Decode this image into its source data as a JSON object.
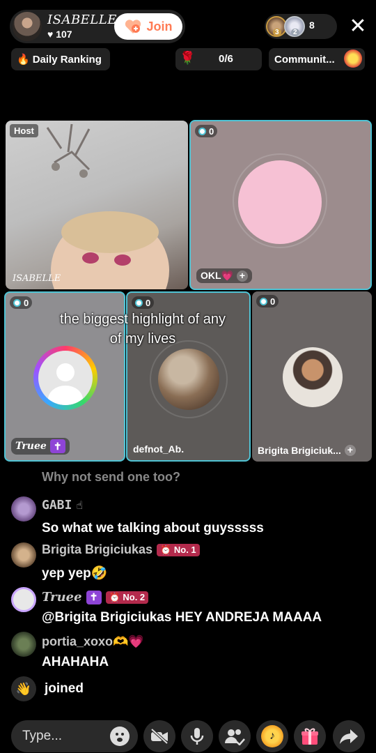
{
  "header": {
    "host_name": "ISABELLE",
    "likes": "107",
    "join_label": "Join",
    "viewer_count": "8",
    "viewer_ranks": [
      "3",
      "2"
    ],
    "close_label": "✕"
  },
  "chips": {
    "daily_ranking": "Daily Ranking",
    "gift_goal": "0/6",
    "community": "Communit..."
  },
  "tiles": {
    "host_tag": "Host",
    "host_name": "ISABELLE",
    "seats": [
      {
        "count": "0",
        "label": "OKL💗"
      },
      {
        "count": "0",
        "label": "Truee"
      },
      {
        "count": "0",
        "label": "defnot_Ab."
      },
      {
        "count": "0",
        "label": "Brigita Brigiciuk..."
      }
    ]
  },
  "caption": "the biggest highlight of any of my lives",
  "chat": {
    "faded": "Why not send one too?",
    "messages": [
      {
        "name": "GABI",
        "text": "So what we talking about guysssss"
      },
      {
        "name": "Brigita Brigiciukas",
        "badge": "No. 1",
        "text": "yep yep🤣"
      },
      {
        "name": "Truee",
        "badge": "No. 2",
        "text": "@Brigita Brigiciukas HEY ANDREJA MAAAA"
      },
      {
        "name": "portia_xoxo🫶💗",
        "text": "AHAHAHA"
      }
    ],
    "joined": "joined"
  },
  "bottom": {
    "placeholder": "Type..."
  },
  "colors": {
    "accent_teal": "#4fc3d4",
    "join_orange": "#ff7b54",
    "rank_badge": "#b32a4c",
    "cross_purple": "#8e44d6"
  }
}
